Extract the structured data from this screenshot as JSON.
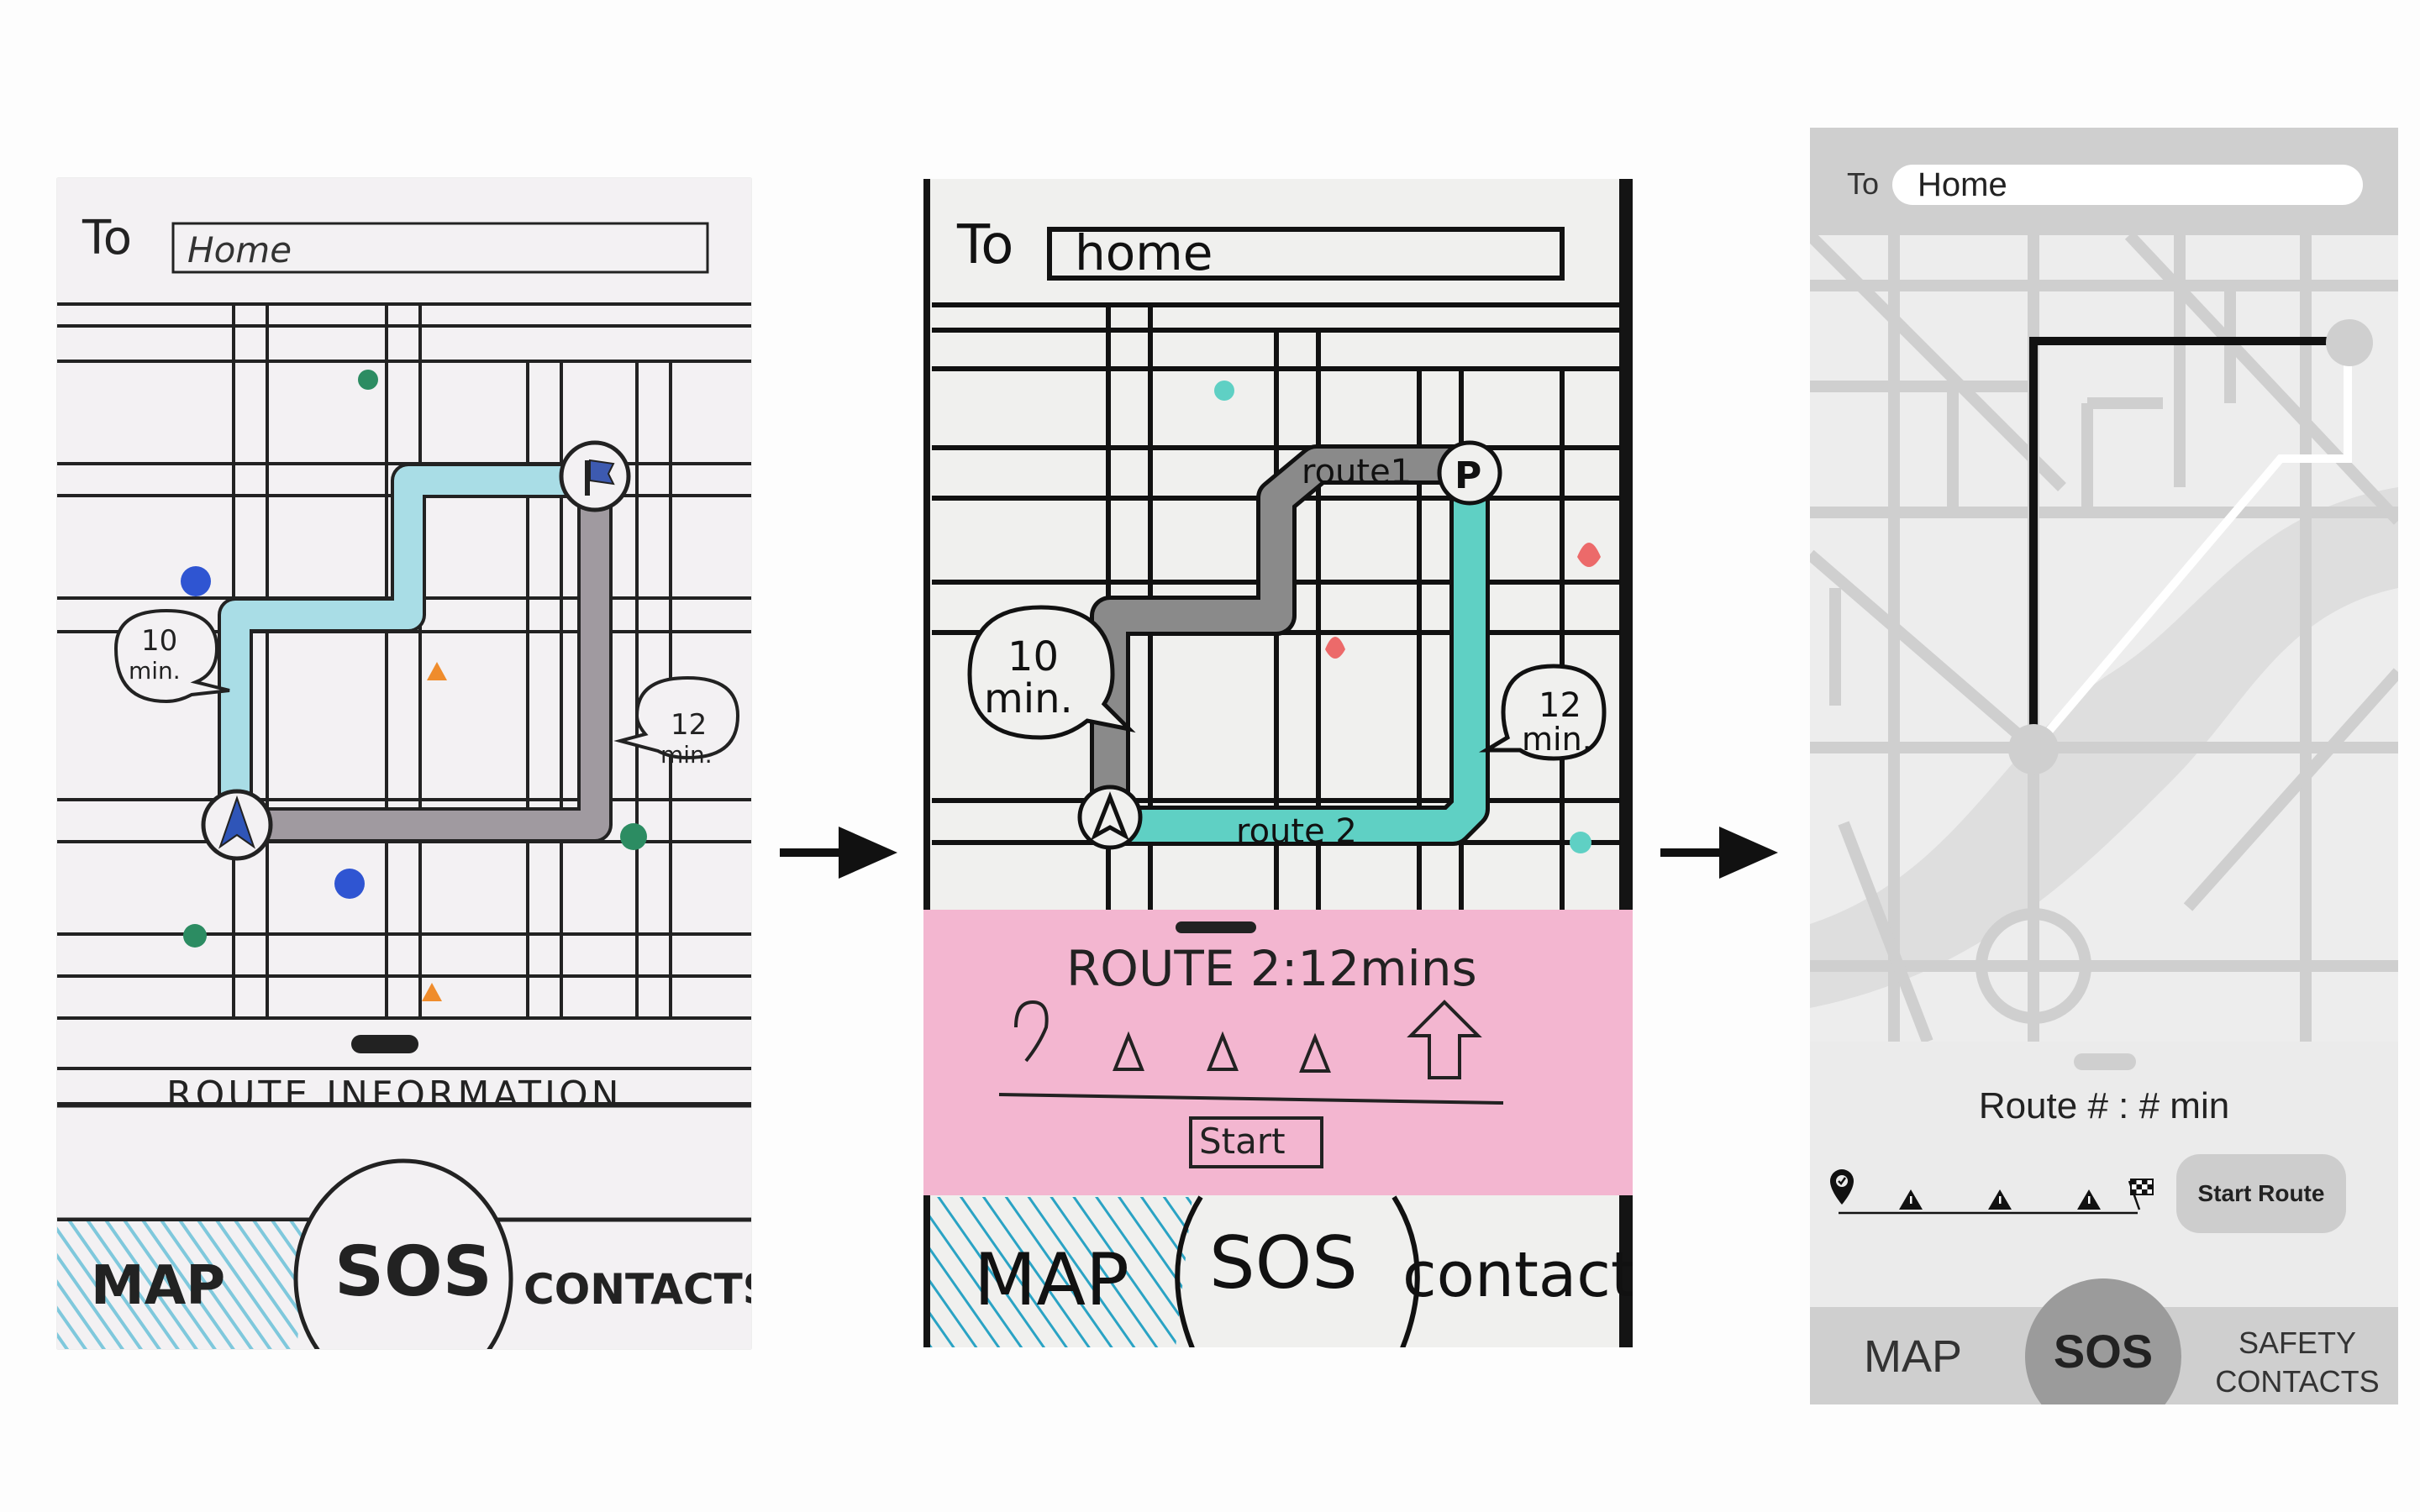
{
  "sketch1": {
    "to_label": "To",
    "destination": "Home",
    "eta_left": "10 min.",
    "eta_right": "12 min.",
    "eta_left_num": "10",
    "eta_left_unit": "min.",
    "eta_right_num": "12",
    "eta_right_unit": "min.",
    "sheet_title": "ROUTE INFORMATION",
    "nav": {
      "map": "MAP",
      "sos": "SOS",
      "contacts": "CONTACTS"
    }
  },
  "sketch2": {
    "to_label": "To",
    "destination": "home",
    "route1_label": "route1",
    "route2_label": "route 2",
    "eta_left_num": "10",
    "eta_left_unit": "min.",
    "eta_right_num": "12",
    "eta_right_unit": "min.",
    "sheet_title": "ROUTE 2:12mins",
    "start_label": "Start",
    "nav": {
      "map": "MAP",
      "sos": "SOS",
      "contacts": "contacts"
    }
  },
  "mockup": {
    "to_label": "To",
    "destination": "Home",
    "route_info": "Route # : # min",
    "start_button": "Start Route",
    "nav": {
      "map": "MAP",
      "sos": "SOS",
      "contacts_line1": "SAFETY",
      "contacts_line2": "CONTACTS"
    }
  },
  "colors": {
    "light_blue_route": "#a9dde6",
    "teal_route": "#5fd0c4",
    "gray_route": "#8a8a8a",
    "sticky_note": "#f3b6d0",
    "mockup_bar": "#cfcfcf",
    "sos_circle": "#9b9b9b"
  },
  "icons": [
    "arrow-right-icon",
    "location-pin-icon",
    "warning-icon",
    "checkered-flag-icon",
    "start-navigation-icon",
    "destination-flag-icon"
  ]
}
